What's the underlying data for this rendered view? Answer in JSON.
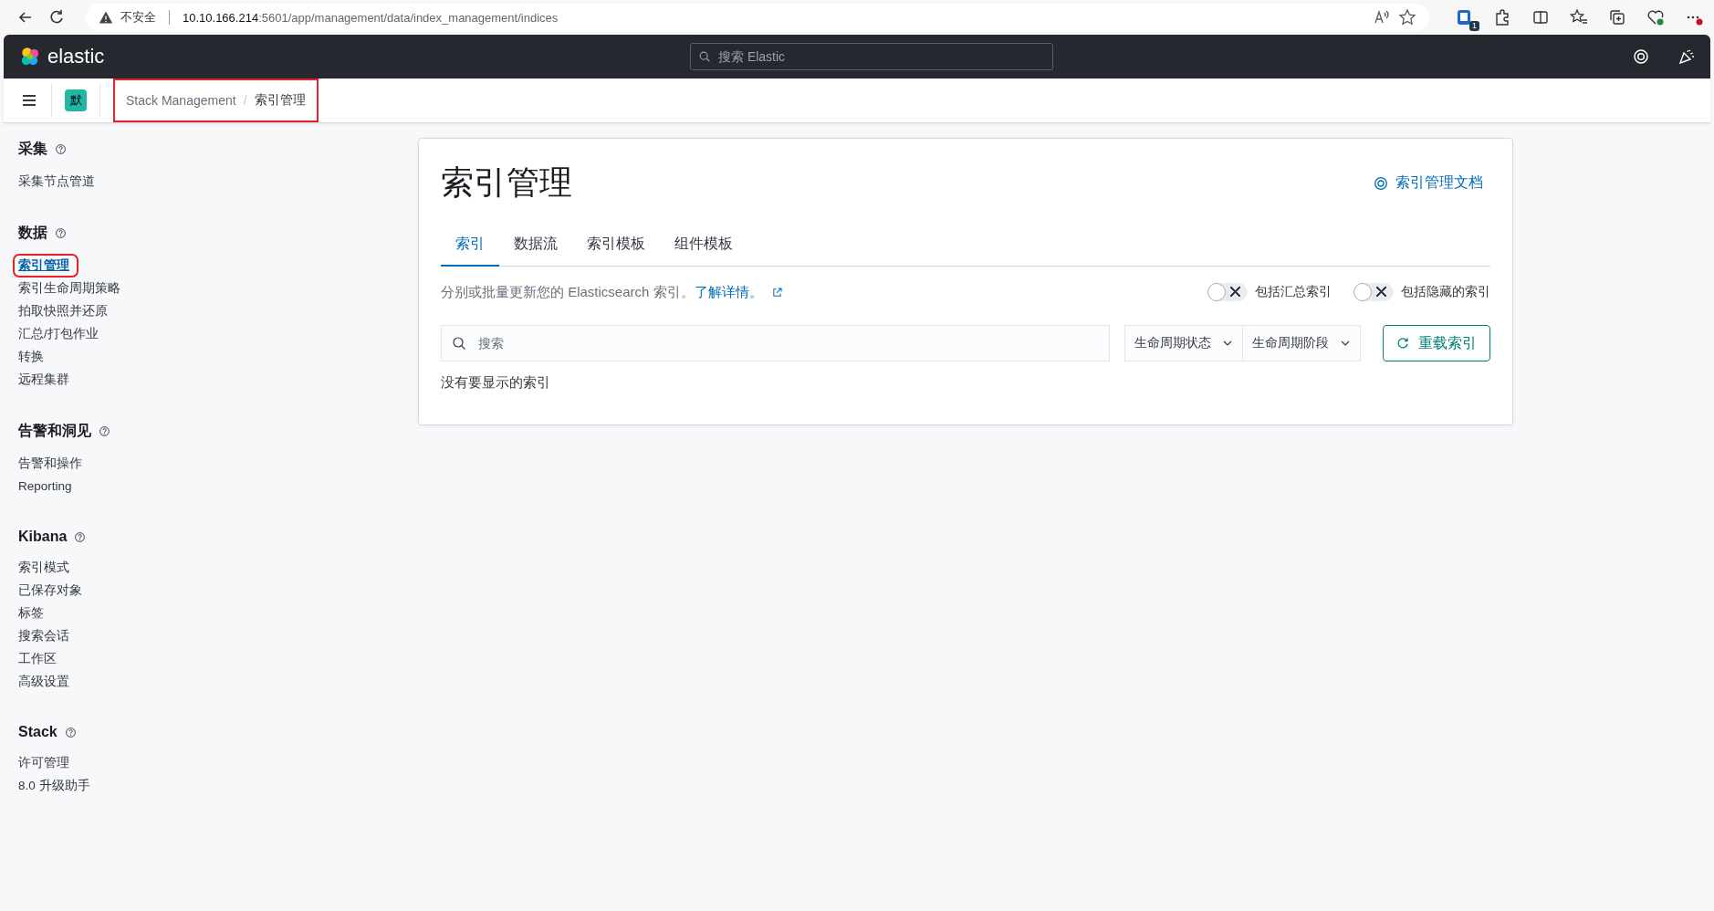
{
  "browser": {
    "security_label": "不安全",
    "url_host": "10.10.166.214",
    "url_path": ":5601/app/management/data/index_management/indices",
    "extension_badge": "1"
  },
  "header": {
    "logo_text": "elastic",
    "search_placeholder": "搜索 Elastic"
  },
  "breadcrumb_bar": {
    "space_avatar": "默",
    "highlighted": true,
    "separator": "/",
    "items": [
      {
        "label": "Stack Management",
        "selected": false
      },
      {
        "label": "索引管理",
        "selected": true
      }
    ]
  },
  "sidebar": {
    "sections": [
      {
        "title": "采集",
        "items": [
          {
            "label": "采集节点管道",
            "selected": false,
            "highlighted": false
          }
        ]
      },
      {
        "title": "数据",
        "items": [
          {
            "label": "索引管理",
            "selected": true,
            "highlighted": true
          },
          {
            "label": "索引生命周期策略",
            "selected": false,
            "highlighted": false
          },
          {
            "label": "拍取快照并还原",
            "selected": false,
            "highlighted": false
          },
          {
            "label": "汇总/打包作业",
            "selected": false,
            "highlighted": false
          },
          {
            "label": "转换",
            "selected": false,
            "highlighted": false
          },
          {
            "label": "远程集群",
            "selected": false,
            "highlighted": false
          }
        ]
      },
      {
        "title": "告警和洞见",
        "items": [
          {
            "label": "告警和操作",
            "selected": false,
            "highlighted": false
          },
          {
            "label": "Reporting",
            "selected": false,
            "highlighted": false
          }
        ]
      },
      {
        "title": "Kibana",
        "items": [
          {
            "label": "索引模式",
            "selected": false,
            "highlighted": false
          },
          {
            "label": "已保存对象",
            "selected": false,
            "highlighted": false
          },
          {
            "label": "标签",
            "selected": false,
            "highlighted": false
          },
          {
            "label": "搜索会话",
            "selected": false,
            "highlighted": false
          },
          {
            "label": "工作区",
            "selected": false,
            "highlighted": false
          },
          {
            "label": "高级设置",
            "selected": false,
            "highlighted": false
          }
        ]
      },
      {
        "title": "Stack",
        "items": [
          {
            "label": "许可管理",
            "selected": false,
            "highlighted": false
          },
          {
            "label": "8.0 升级助手",
            "selected": false,
            "highlighted": false
          }
        ]
      }
    ]
  },
  "panel": {
    "title": "索引管理",
    "docs_link": "索引管理文档",
    "tabs": [
      {
        "label": "索引",
        "selected": true
      },
      {
        "label": "数据流",
        "selected": false
      },
      {
        "label": "索引模板",
        "selected": false
      },
      {
        "label": "组件模板",
        "selected": false
      }
    ],
    "description": "分别或批量更新您的 Elasticsearch 索引。",
    "learn_more": "了解详情。",
    "toggles": [
      {
        "label": "包括汇总索引",
        "on": false
      },
      {
        "label": "包括隐藏的索引",
        "on": false
      }
    ],
    "search_placeholder": "搜索",
    "filters": [
      "生命周期状态",
      "生命周期阶段"
    ],
    "reload_button": "重载索引",
    "empty_message": "没有要显示的索引"
  }
}
